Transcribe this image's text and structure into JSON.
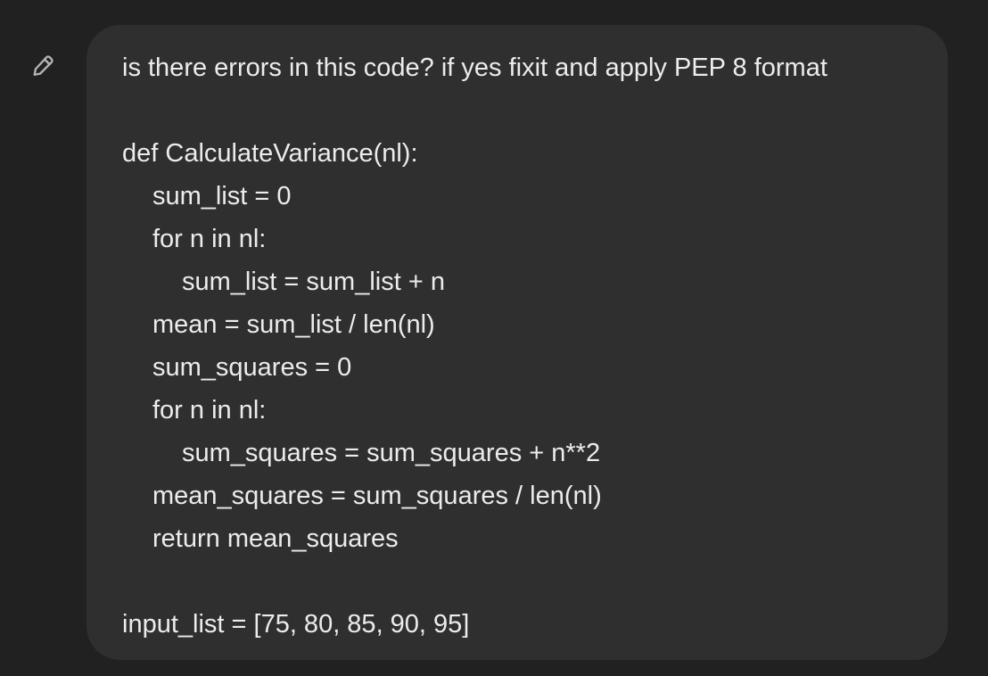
{
  "edit_button": {
    "icon": "pencil-icon"
  },
  "message": {
    "question": "is there errors in this code? if yes fixit and apply PEP 8 format",
    "code_lines": [
      "def CalculateVariance(nl):",
      "sum_list = 0",
      "for n in nl:",
      "sum_list = sum_list + n",
      "mean = sum_list / len(nl)",
      "sum_squares = 0",
      "for n in nl:",
      "sum_squares = sum_squares + n**2",
      "mean_squares = sum_squares / len(nl)",
      "return mean_squares"
    ],
    "input_line": "input_list = [75, 80, 85, 90, 95]"
  },
  "colors": {
    "background": "#212121",
    "bubble": "#2f2f2f",
    "text": "#ececec",
    "icon": "#b4b4b4"
  }
}
